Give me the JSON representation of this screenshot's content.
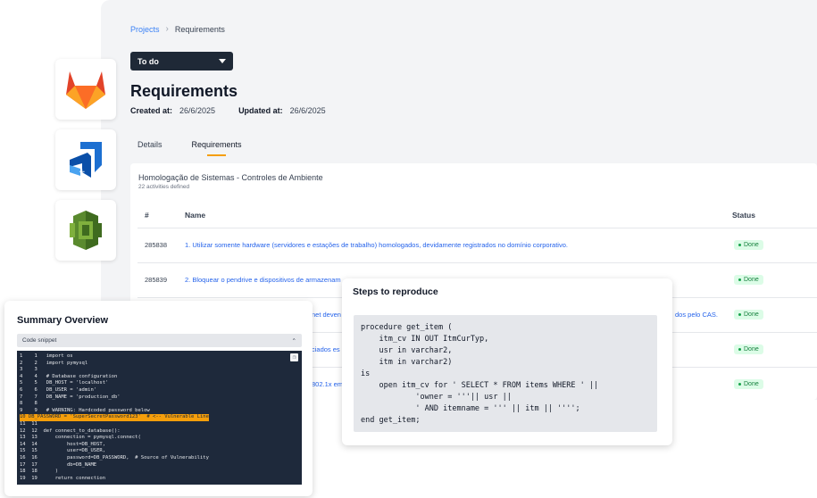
{
  "breadcrumb": {
    "parent": "Projects",
    "current": "Requirements"
  },
  "status_select": {
    "value": "To do"
  },
  "page": {
    "title": "Requirements",
    "created_label": "Created at:",
    "created_value": "26/6/2025",
    "updated_label": "Updated at:",
    "updated_value": "26/6/2025"
  },
  "tabs": [
    {
      "label": "Details"
    },
    {
      "label": "Requirements"
    }
  ],
  "card": {
    "title": "Homologação de Sistemas - Controles de Ambiente",
    "subtitle": "22 activities defined",
    "columns": {
      "id": "#",
      "name": "Name",
      "status": "Status"
    },
    "rows": [
      {
        "id": "285838",
        "name": "1. Utilizar somente hardware (servidores e estações de trabalho) homologados, devidamente registrados no domínio corporativo.",
        "status": "Done"
      },
      {
        "id": "285839",
        "name": "2. Bloquear o pendrive e dispositivos de armazenam",
        "status": "Done"
      },
      {
        "id": "",
        "name": "net deven",
        "tail": "dos pelo CAS.",
        "status": "Done"
      },
      {
        "id": "",
        "name": "ciados es",
        "status": "Done"
      },
      {
        "id": "",
        "name": "802.1x em",
        "status": "Done"
      }
    ]
  },
  "tools": [
    "gitlab-icon",
    "azure-devops-icon",
    "aws-codecommit-icon"
  ],
  "colors": {
    "accent": "#f59e0b",
    "link": "#2563eb",
    "done_bg": "#dcfce7",
    "done_text": "#15803d"
  },
  "summary": {
    "title": "Summary Overview",
    "snippet_label": "Code snippet",
    "code_lines": [
      "1    1   import os",
      "2    2   import pymysql",
      "3    3",
      "4    4   # Database configuration",
      "5    5   DB_HOST = 'localhost'",
      "6    6   DB_USER = 'admin'",
      "7    7   DB_NAME = 'production_db'",
      "8    8",
      "9    9   # WARNING: Hardcoded password below",
      "10 DB_PASSWORD = 'SuperSecretPassword123'  # <-- Vulnerable Line",
      "11  11",
      "12  12  def connect_to_database():",
      "13  13      connection = pymysql.connect(",
      "14  14          host=DB_HOST,",
      "15  15          user=DB_USER,",
      "16  16          password=DB_PASSWORD,  # Source of Vulnerability",
      "17  17          db=DB_NAME",
      "18  18      )",
      "19  19      return connection"
    ]
  },
  "steps": {
    "title": "Steps to reproduce",
    "code_lines": [
      "procedure get_item (",
      "    itm_cv IN OUT ItmCurTyp,",
      "    usr in varchar2,",
      "    itm in varchar2)",
      "is",
      "    open itm_cv for ' SELECT * FROM items WHERE ' ||",
      "            'owner = '''|| usr ||",
      "            ' AND itemname = ''' || itm || '''';",
      "end get_item;"
    ]
  }
}
